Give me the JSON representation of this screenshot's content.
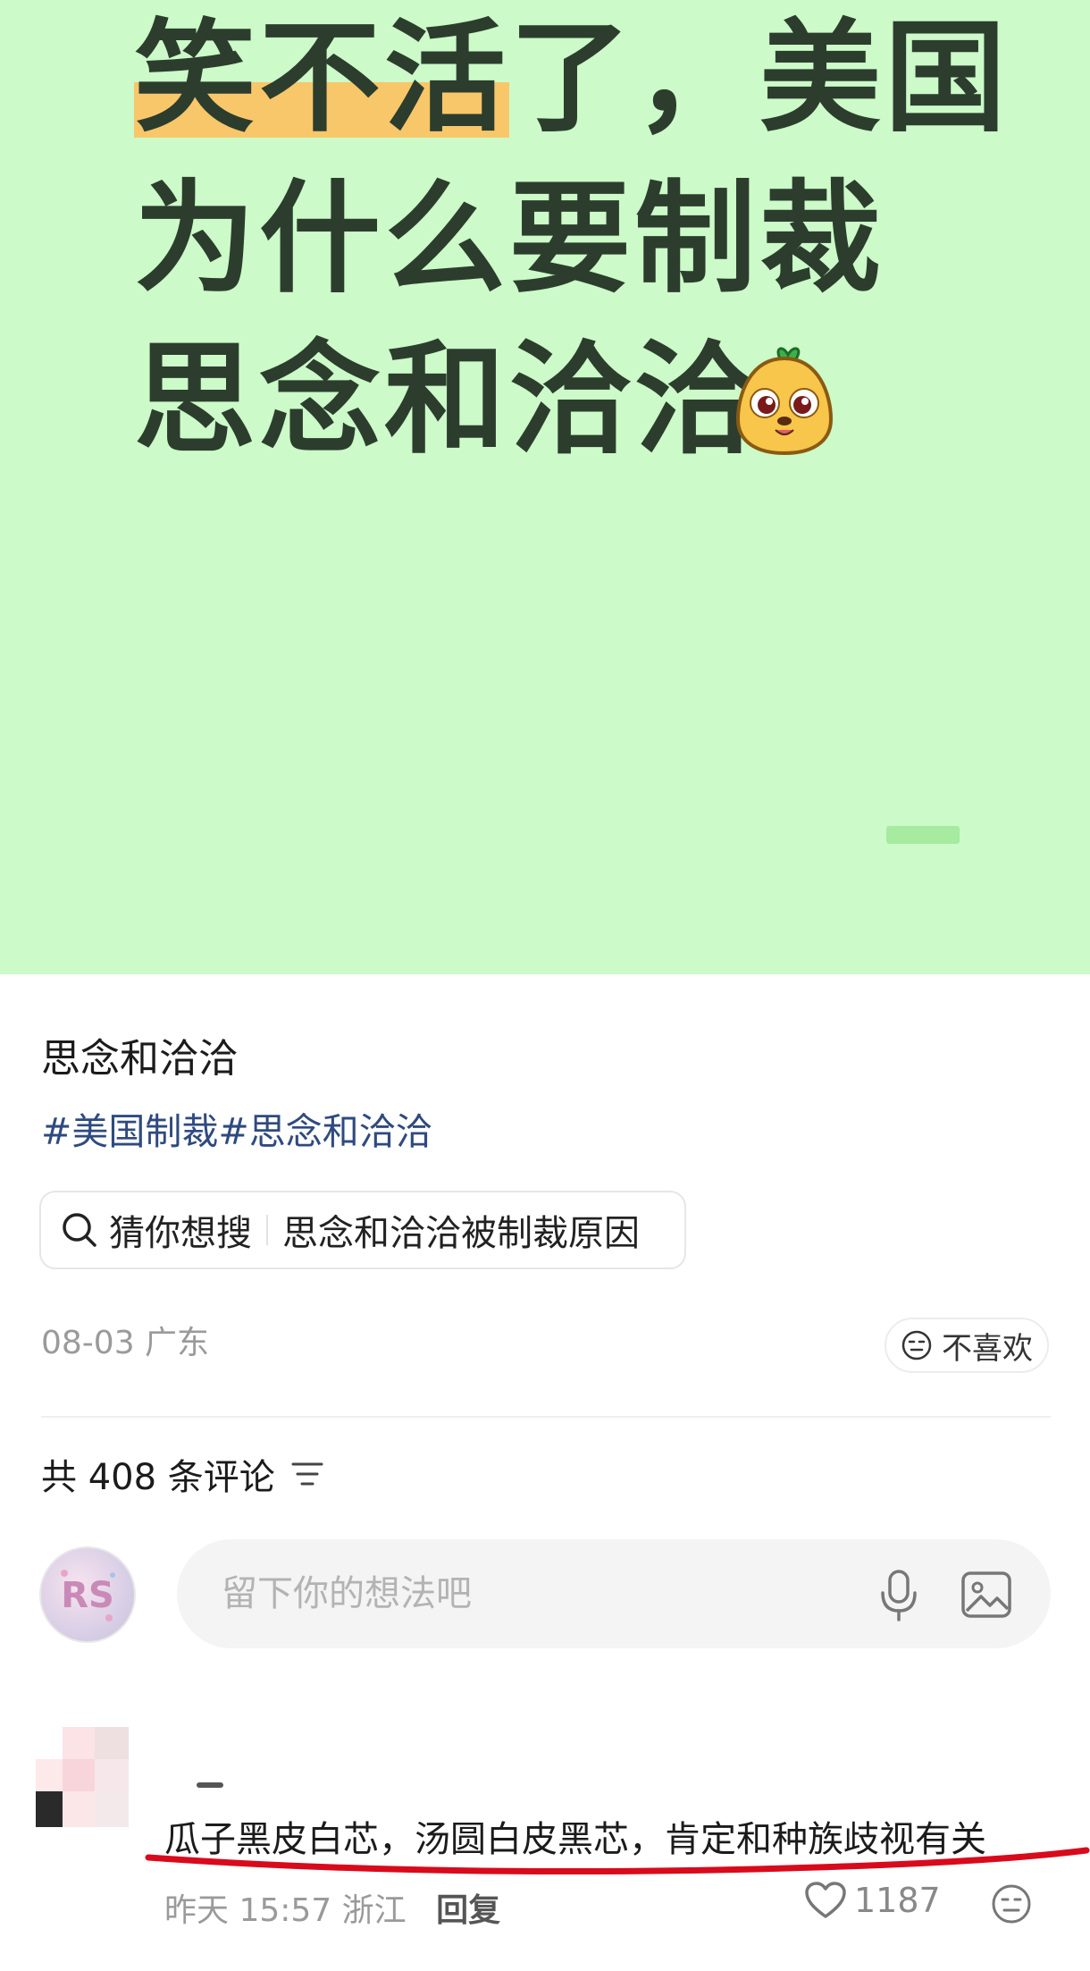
{
  "hero": {
    "line1_highlight": "笑不活",
    "line1_rest": "了，美国",
    "line2": "为什么要制裁",
    "line3": "思念和洽洽",
    "mascot_icon": "sunflower-seed-mascot",
    "bg_color": "#ccfac8",
    "highlight_color": "#f8c76a"
  },
  "post": {
    "title": "思念和洽洽",
    "tags": "#美国制裁#思念和洽洽",
    "guess_prefix": "猜你想搜",
    "guess_query": "思念和洽洽被制裁原因",
    "date_location": "08-03 广东",
    "dislike_label": "不喜欢"
  },
  "comments": {
    "count_label": "共 408 条评论",
    "input_placeholder": "留下你的想法吧",
    "items": [
      {
        "text": "瓜子黑皮白芯，汤圆白皮黑芯，肯定和种族歧视有关",
        "time": "昨天 15:57",
        "location": "浙江",
        "reply_label": "回复",
        "likes": "1187"
      }
    ]
  },
  "colors": {
    "tag_blue": "#2f4a80",
    "annotation_red": "#d90a1c"
  }
}
